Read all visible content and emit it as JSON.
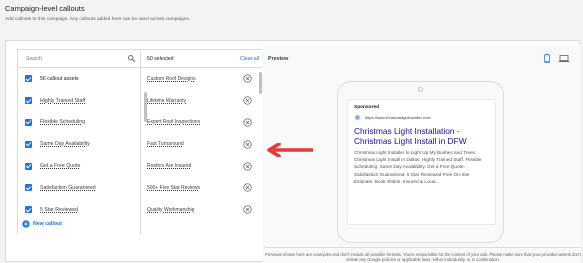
{
  "header": {
    "title": "Campaign-level callouts",
    "subtitle": "Add callouts to this campaign. Any callouts added here can be used across campaigns."
  },
  "search": {
    "placeholder": "Search"
  },
  "left_list": {
    "items": [
      {
        "label": "56 callout assets"
      },
      {
        "label": "Highly Trained Staff"
      },
      {
        "label": "Flexible Scheduling"
      },
      {
        "label": "Same Day Availability"
      },
      {
        "label": "Get a Free Quote"
      },
      {
        "label": "Satisfaction Guaranteed"
      },
      {
        "label": "5 Star Reviewed"
      }
    ],
    "new_callout_label": "New callout"
  },
  "selected": {
    "count_label": "50 selected",
    "clear_all_label": "Clear all",
    "items": [
      {
        "label": "Custom Roof Designs"
      },
      {
        "label": "Lifetime Warranty"
      },
      {
        "label": "Expert Roof Inspections"
      },
      {
        "label": "Fast Turnaround"
      },
      {
        "label": "Roofers Are Insured"
      },
      {
        "label": "500+ Five Star Reviews"
      },
      {
        "label": "Quality Workmanship"
      }
    ]
  },
  "preview": {
    "title": "Preview",
    "ad": {
      "sponsored": "Sponsored",
      "url": "https://www.christmaslightinstaller.com/",
      "headline": "Christmas Light Installation - Christmas Light Install in DFW",
      "description": "Christmas Light Installer to Light Up My Bushes and Trees. Christmas Light Install in Dallas. Highly Trained Staff. Flexible Scheduling. Same Day Availability. Get a Free Quote. Satisfaction Guaranteed. 5 Star Reviewed Free On-Site Estimate. Book Online. Insured & Local..."
    },
    "disclaimer": "Previews shown here are examples and don't include all possible formats. You're responsible for the content of your ads. Please make sure that your provided assets don't violate any Google policies or applicable laws, either individually, or in combination."
  },
  "colors": {
    "accent": "#1a73e8",
    "arrow": "#e53935",
    "headline": "#1a0dab"
  }
}
